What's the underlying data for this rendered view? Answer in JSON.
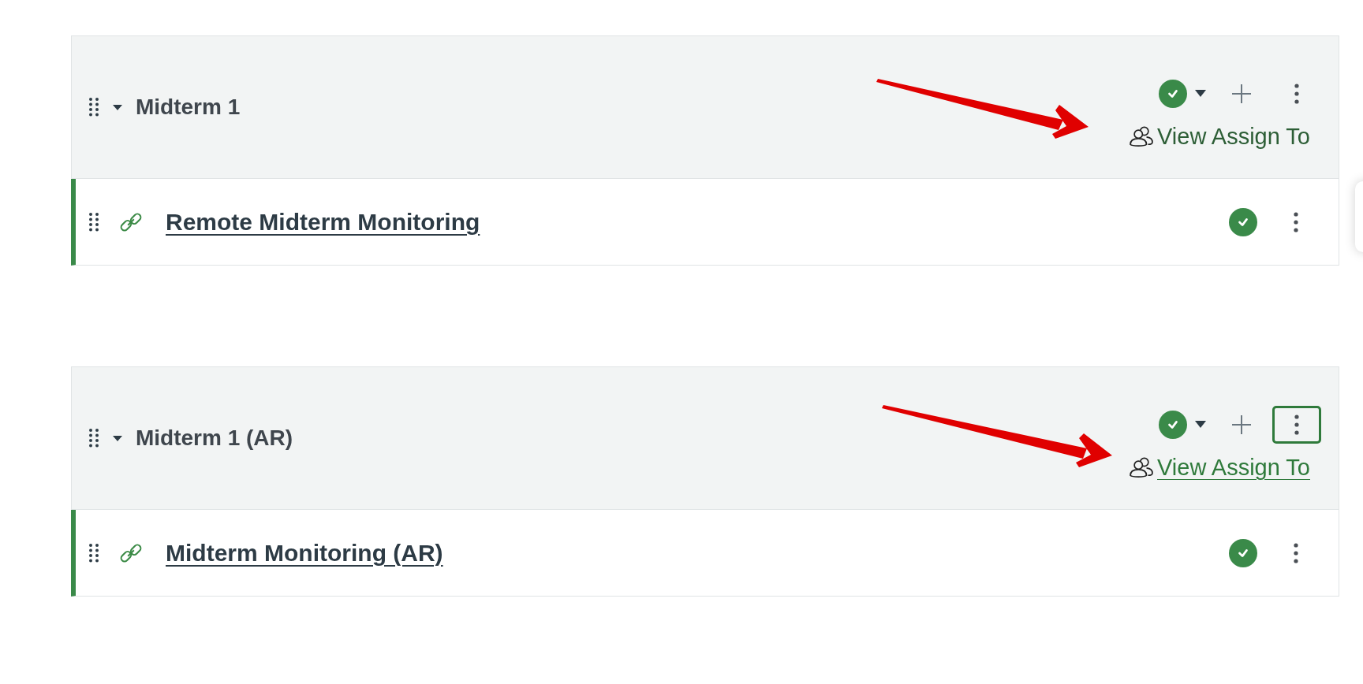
{
  "modules": [
    {
      "title": "Midterm 1",
      "expanded": true,
      "published": true,
      "menu_focused": false,
      "assign_link": {
        "label": "View Assign To",
        "hovered": false
      },
      "items": [
        {
          "title": "Remote Midterm Monitoring",
          "published": true
        }
      ]
    },
    {
      "title": "Midterm 1 (AR)",
      "expanded": true,
      "published": true,
      "menu_focused": true,
      "assign_link": {
        "label": "View Assign To",
        "hovered": true
      },
      "items": [
        {
          "title": "Midterm Monitoring (AR)",
          "published": true
        }
      ]
    }
  ]
}
